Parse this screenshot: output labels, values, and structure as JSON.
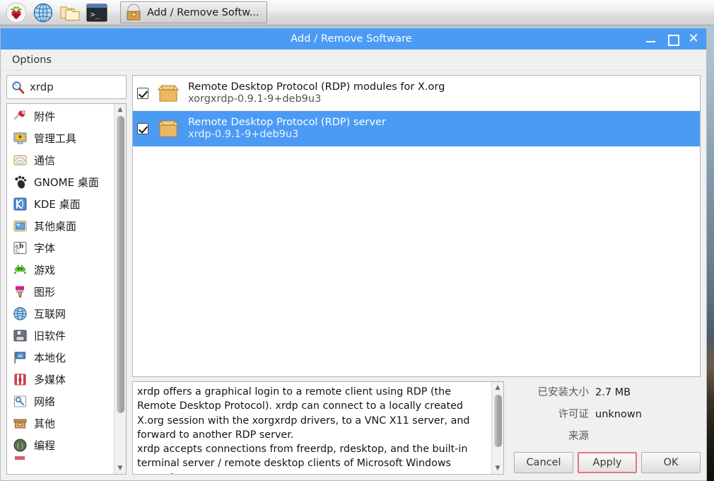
{
  "taskbar": {
    "icons": [
      {
        "name": "raspberry-menu-icon",
        "label": "Raspberry Pi Menu"
      },
      {
        "name": "web-browser-icon",
        "label": "Web Browser"
      },
      {
        "name": "file-manager-icon",
        "label": "File Manager"
      },
      {
        "name": "terminal-icon",
        "label": "Terminal"
      }
    ],
    "task_button": {
      "label": "Add / Remove Softw...",
      "icon": "package-manager-icon"
    }
  },
  "window": {
    "title": "Add / Remove Software",
    "controls": {
      "minimize": "minimize-button",
      "maximize": "maximize-button",
      "close": "close-button"
    }
  },
  "menubar": {
    "items": [
      "Options"
    ]
  },
  "search": {
    "value": "xrdp",
    "placeholder": "",
    "icon": "search-icon"
  },
  "categories": [
    {
      "label": "附件",
      "icon": "accessories-icon"
    },
    {
      "label": "管理工具",
      "icon": "admin-tools-icon"
    },
    {
      "label": "通信",
      "icon": "communication-icon"
    },
    {
      "label": "GNOME 桌面",
      "icon": "gnome-desktop-icon"
    },
    {
      "label": "KDE 桌面",
      "icon": "kde-desktop-icon"
    },
    {
      "label": "其他桌面",
      "icon": "other-desktop-icon"
    },
    {
      "label": "字体",
      "icon": "fonts-icon"
    },
    {
      "label": "游戏",
      "icon": "games-icon"
    },
    {
      "label": "图形",
      "icon": "graphics-icon"
    },
    {
      "label": "互联网",
      "icon": "internet-icon"
    },
    {
      "label": "旧软件",
      "icon": "legacy-software-icon"
    },
    {
      "label": "本地化",
      "icon": "localization-icon"
    },
    {
      "label": "多媒体",
      "icon": "multimedia-icon"
    },
    {
      "label": "网络",
      "icon": "network-icon"
    },
    {
      "label": "其他",
      "icon": "other-icon"
    },
    {
      "label": "编程",
      "icon": "programming-icon"
    },
    {
      "label": "",
      "icon": "partial-icon"
    }
  ],
  "packages": [
    {
      "title": "Remote Desktop Protocol (RDP) modules for X.org",
      "version": "xorgxrdp-0.9.1-9+deb9u3",
      "checked": true,
      "selected": false,
      "icon": "package-box-icon"
    },
    {
      "title": "Remote Desktop Protocol (RDP) server",
      "version": "xrdp-0.9.1-9+deb9u3",
      "checked": true,
      "selected": true,
      "icon": "package-box-icon"
    }
  ],
  "description": "xrdp offers a graphical login to a remote client using RDP (the Remote Desktop Protocol). xrdp can connect to a locally created X.org session with the xorgxrdp drivers, to a VNC X11 server, and forward to another RDP server.\nxrdp accepts connections from freerdp, rdesktop, and the built-in terminal server / remote desktop clients of Microsoft Windows operating systems.",
  "info": {
    "rows": [
      {
        "label": "已安装大小",
        "value": "2.7 MB"
      },
      {
        "label": "许可证",
        "value": "unknown"
      },
      {
        "label": "来源",
        "value": ""
      }
    ]
  },
  "buttons": {
    "cancel": "Cancel",
    "apply": "Apply",
    "ok": "OK"
  },
  "colors": {
    "titlebar": "#4b9bf5",
    "selection": "#4b9bf5",
    "apply_highlight": "#e2757d",
    "window_bg": "#f0f0f0"
  }
}
